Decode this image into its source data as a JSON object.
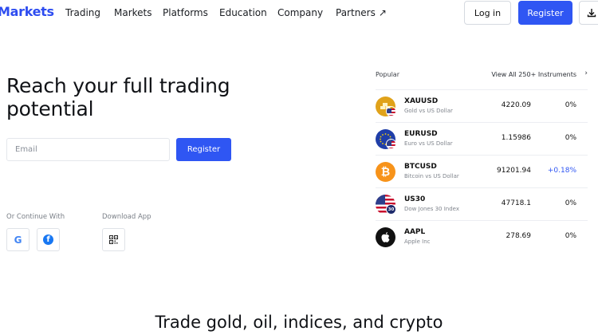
{
  "nav": {
    "logo": "Markets",
    "links": [
      "Trading",
      "Markets",
      "Platforms",
      "Education",
      "Company",
      "Partners"
    ],
    "partners_arrow": "↗",
    "login_label": "Log in",
    "register_label": "Register",
    "download_icon": "download-icon"
  },
  "hero": {
    "title": "Reach your full trading potential",
    "email_placeholder": "Email",
    "register_label": "Register",
    "continue_with_label": "Or Continue With",
    "download_app_label": "Download App",
    "google_glyph": "G",
    "facebook_glyph": "f"
  },
  "instruments": {
    "popular_label": "Popular",
    "view_all_label": "View All 250+ Instruments",
    "rows": [
      {
        "symbol": "XAUUSD",
        "name": "Gold vs US Dollar",
        "price": "4220.09",
        "change": "0%"
      },
      {
        "symbol": "EURUSD",
        "name": "Euro vs US Dollar",
        "price": "1.15986",
        "change": "0%"
      },
      {
        "symbol": "BTCUSD",
        "name": "Bitcoin vs US Dollar",
        "price": "91201.94",
        "change": "+0.18%"
      },
      {
        "symbol": "US30",
        "name": "Dow Jones 30 Index",
        "price": "47718.1",
        "change": "0%"
      },
      {
        "symbol": "AAPL",
        "name": "Apple Inc",
        "price": "278.69",
        "change": "0%"
      }
    ],
    "us30_badge": "30",
    "btc_glyph": "₿"
  },
  "bottom": {
    "title": "Trade gold, oil, indices, and crypto"
  },
  "colors": {
    "accent": "#2f56f3",
    "positive_change": "#2f56f3",
    "gold": "#e0a21a",
    "bitcoin": "#f7931a"
  }
}
